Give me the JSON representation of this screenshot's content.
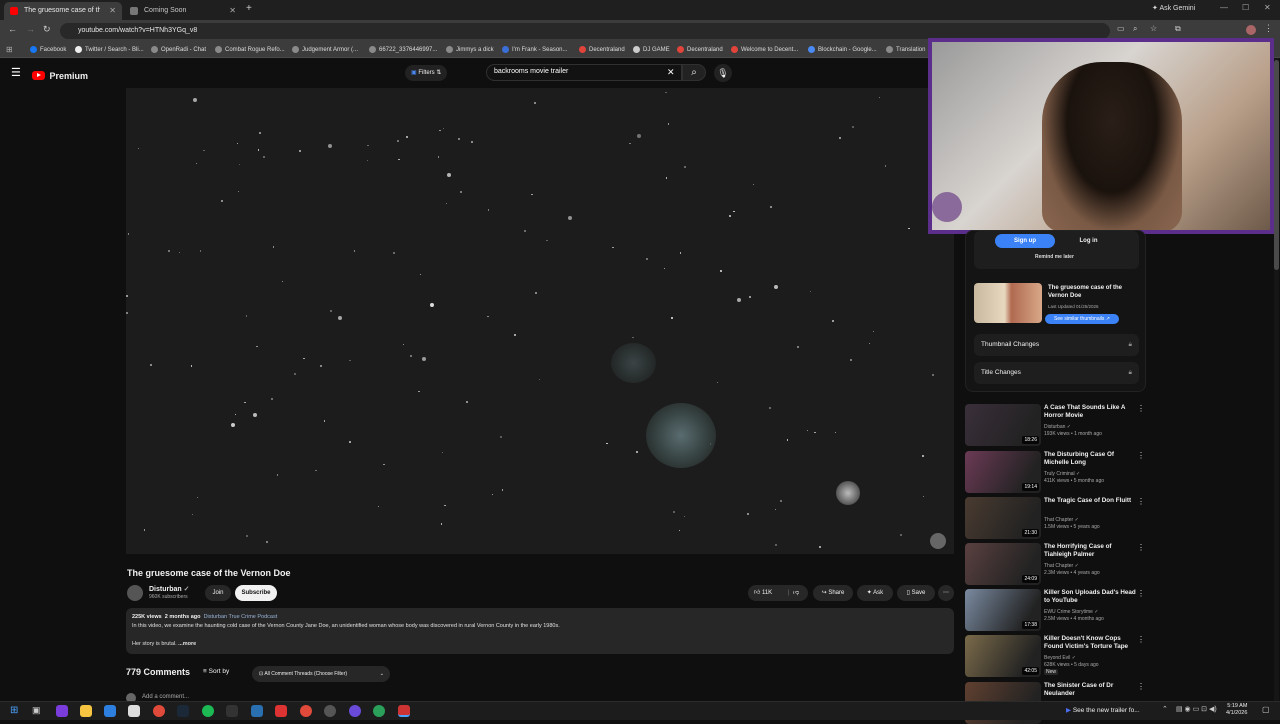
{
  "browser": {
    "tabs": [
      {
        "label": "The gruesome case of the Vernon Doe",
        "active": true
      },
      {
        "label": "Coming Soon",
        "active": false
      }
    ],
    "new_tab": "+",
    "url": "youtube.com/watch?v=HTNh3YGq_v8",
    "ask_gemini": "Ask Gemini",
    "bookmarks": [
      "Facebook",
      "Twitter / Search - Bli...",
      "OpenRadi - Chat",
      "Combat Rogue Refo...",
      "Judgement Armor (...",
      "66722_3376446997...",
      "Jimmys a dick",
      "I'm Frank - Season...",
      "Decentraland",
      "DJ GAME",
      "Decentraland",
      "Welcome to Decent...",
      "Blockchain - Google...",
      "Translation"
    ]
  },
  "youtube": {
    "logo": "Premium",
    "filters": "Filters",
    "search_value": "backrooms movie trailer"
  },
  "video": {
    "title": "The gruesome case of the Vernon Doe",
    "channel": "Disturban",
    "subscribers": "960K subscribers",
    "join": "Join",
    "subscribe": "Subscribe",
    "likes": "11K",
    "share": "Share",
    "ask": "Ask",
    "save": "Save",
    "views": "225K views",
    "age": "2 months ago",
    "podcast": "Disturban True Crime Podcast",
    "description": "In this video, we examine the haunting cold case of the Vernon County Jane Doe, an unidentified woman whose body was discovered in rural Vernon County in the early 1980s.",
    "description2": "Her story is brutal.",
    "more": "...more"
  },
  "comments": {
    "count": "779 Comments",
    "sort": "Sort by",
    "filter": "All Comment Threads (Choose Filter)",
    "add": "Add a comment..."
  },
  "sidebar": {
    "signup": "Sign up",
    "login": "Log in",
    "remind": "Remind me later",
    "card_title": "The gruesome case of the Vernon Doe",
    "last_updated": "Last Updated 01/25/2026",
    "similar": "See similar thumbnails",
    "thumb_changes": "Thumbnail Changes",
    "title_changes": "Title Changes"
  },
  "recommendations": [
    {
      "title": "A Case That Sounds Like A Horror Movie",
      "channel": "Disturban",
      "meta": "193K views • 1 month ago",
      "duration": "18:26",
      "color": "#3a2f3a"
    },
    {
      "title": "The Disturbing Case Of Michelle Long",
      "channel": "Truly Criminal",
      "meta": "411K views • 5 months ago",
      "duration": "19:14",
      "color": "#6b3a55"
    },
    {
      "title": "The Tragic Case of Don Fluitt",
      "channel": "That Chapter",
      "meta": "1.5M views • 5 years ago",
      "duration": "21:30",
      "color": "#4a3b30"
    },
    {
      "title": "The Horrifying Case of Tiahleigh Palmer",
      "channel": "That Chapter",
      "meta": "2.3M views • 4 years ago",
      "duration": "24:09",
      "color": "#5a4040"
    },
    {
      "title": "Killer Son Uploads Dad's Head to YouTube",
      "channel": "EWU Crime Storytime",
      "meta": "2.5M views • 4 months ago",
      "duration": "17:38",
      "color": "#7a8aa0"
    },
    {
      "title": "Killer Doesn't Know Cops Found Victim's Torture Tape",
      "channel": "Beyond Evil",
      "meta": "628K views • 5 days ago",
      "duration": "42:05",
      "color": "#7a6a4a",
      "badge": "New"
    },
    {
      "title": "The Sinister Case of Dr Neulander",
      "channel": "",
      "meta": "",
      "duration": "",
      "color": "#604030"
    }
  ],
  "taskbar": {
    "notification": "See the new trailer fo...",
    "time": "5:19 AM",
    "date": "4/1/2026"
  }
}
